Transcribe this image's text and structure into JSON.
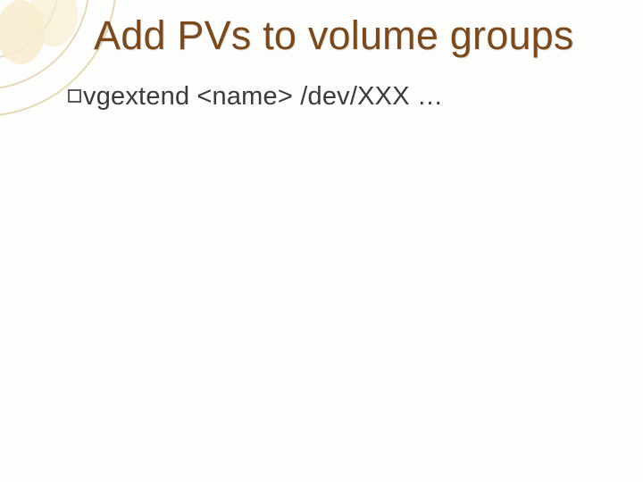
{
  "title": "Add PVs to volume groups",
  "body": {
    "command": "vgextend",
    "args": "<name> /dev/XXX …"
  }
}
